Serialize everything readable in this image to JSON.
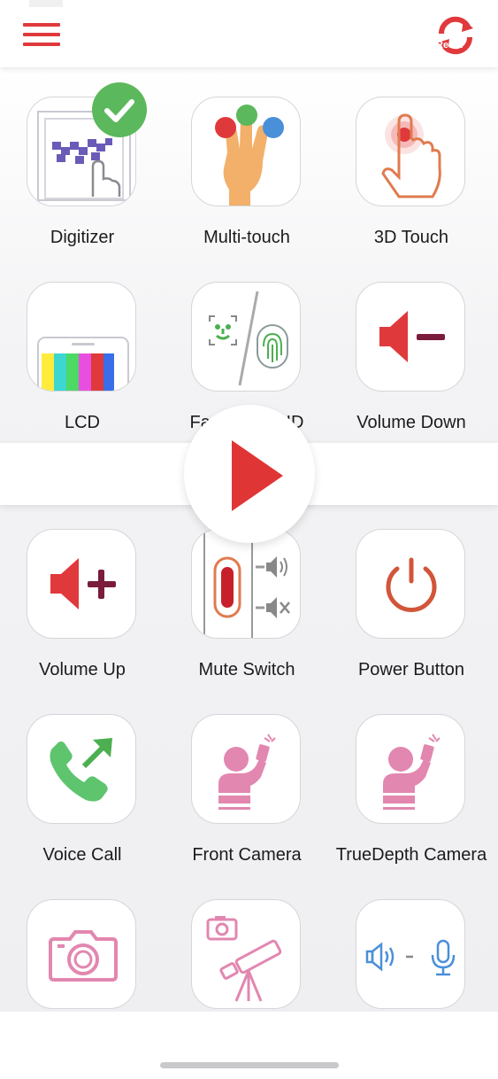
{
  "header": {
    "menu_icon": "hamburger-menu-icon",
    "refresh_icon": "refresh-icon",
    "refresh_label": "Reset",
    "accent_color": "#e0393c"
  },
  "tests": [
    {
      "label": "Digitizer",
      "icon": "digitizer-icon",
      "completed": true
    },
    {
      "label": "Multi-touch",
      "icon": "multi-touch-icon"
    },
    {
      "label": "3D Touch",
      "icon": "3d-touch-icon"
    },
    {
      "label": "LCD",
      "icon": "lcd-icon"
    },
    {
      "label": "Face/Touch ID",
      "icon": "face-touch-id-icon"
    },
    {
      "label": "Volume Down",
      "icon": "volume-down-icon"
    },
    {
      "label": "Volume Up",
      "icon": "volume-up-icon"
    },
    {
      "label": "Mute Switch",
      "icon": "mute-switch-icon"
    },
    {
      "label": "Power Button",
      "icon": "power-button-icon"
    },
    {
      "label": "Voice Call",
      "icon": "voice-call-icon"
    },
    {
      "label": "Front Camera",
      "icon": "front-camera-icon"
    },
    {
      "label": "TrueDepth Camera",
      "icon": "truedepth-camera-icon"
    },
    {
      "label": "",
      "icon": "rear-camera-icon"
    },
    {
      "label": "",
      "icon": "telephoto-camera-icon"
    },
    {
      "label": "",
      "icon": "speaker-microphone-icon"
    }
  ],
  "play_button": {
    "icon": "play-icon",
    "color": "#e03535"
  },
  "completed_badge": {
    "icon": "checkmark-icon",
    "color": "#5cb85c"
  }
}
